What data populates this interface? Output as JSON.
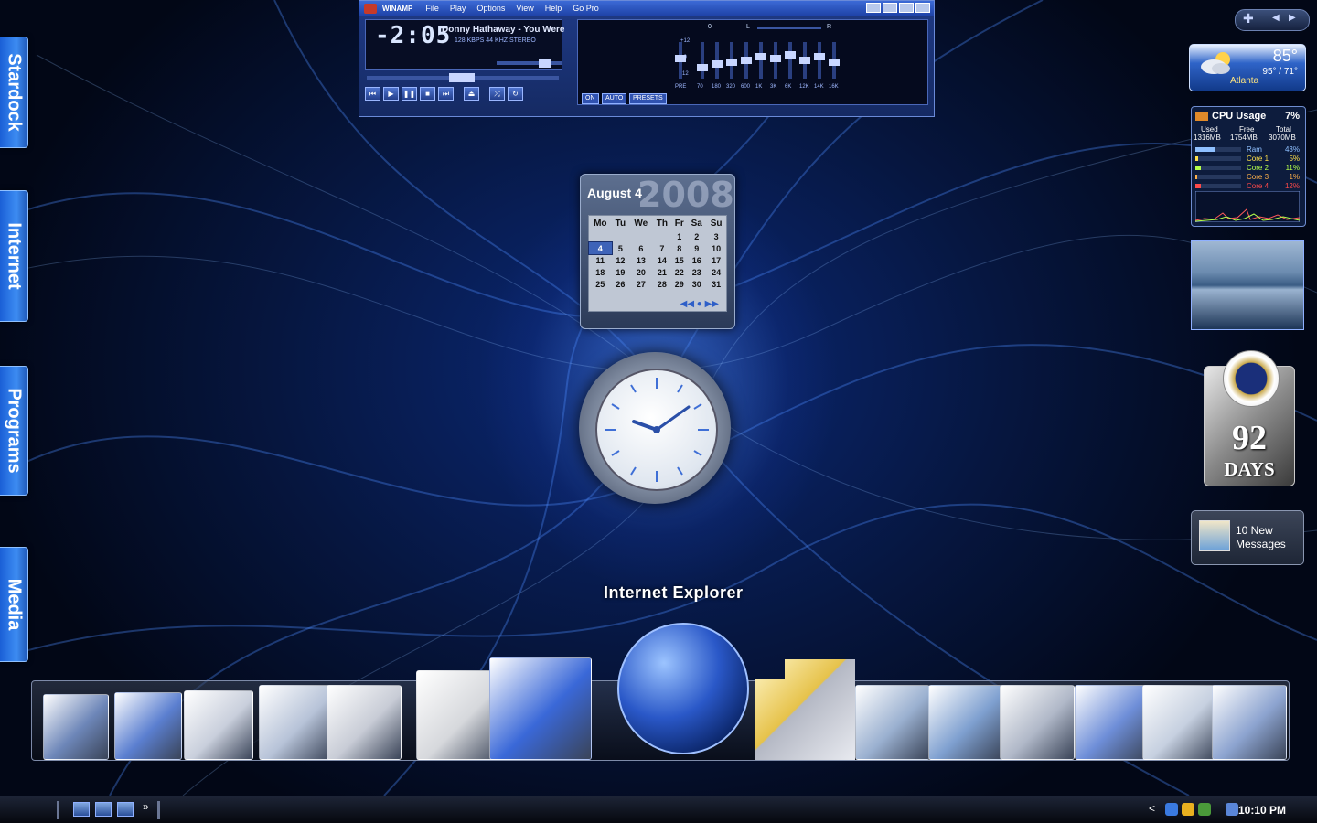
{
  "sidebar_tabs": [
    {
      "label": "Stardock"
    },
    {
      "label": "Internet"
    },
    {
      "label": "Programs"
    },
    {
      "label": "Media"
    }
  ],
  "winamp": {
    "app_name": "WINAMP",
    "menu": [
      "File",
      "Play",
      "Options",
      "View",
      "Help",
      "Go Pro"
    ],
    "time": "-2:05",
    "song": "Donny Hathaway - You Were",
    "kbps": "128",
    "kbps_unit": "KBPS",
    "khz": "44",
    "khz_unit": "KHZ",
    "stereo": "STEREO",
    "eq_labels": [
      "PRE",
      "70",
      "180",
      "320",
      "600",
      "1K",
      "3K",
      "6K",
      "12K",
      "14K",
      "16K"
    ],
    "eq_scale": [
      "+12",
      "+0",
      "-12"
    ],
    "eq_buttons": [
      "ON",
      "AUTO",
      "PRESETS"
    ],
    "balance_left": "L",
    "balance_right": "R",
    "balance_center": "0"
  },
  "calendar": {
    "month_day": "August 4",
    "year": "2008",
    "weekdays": [
      "Mo",
      "Tu",
      "We",
      "Th",
      "Fr",
      "Sa",
      "Su"
    ],
    "weeks": [
      [
        "",
        "",
        "",
        "",
        "1",
        "2",
        "3"
      ],
      [
        "4",
        "5",
        "6",
        "7",
        "8",
        "9",
        "10"
      ],
      [
        "11",
        "12",
        "13",
        "14",
        "15",
        "16",
        "17"
      ],
      [
        "18",
        "19",
        "20",
        "21",
        "22",
        "23",
        "24"
      ],
      [
        "25",
        "26",
        "27",
        "28",
        "29",
        "30",
        "31"
      ]
    ],
    "today": "4"
  },
  "weather": {
    "temp": "85°",
    "hi_lo": "95° / 71°",
    "city": "Atlanta"
  },
  "cpu": {
    "title": "CPU Usage",
    "percent": "7%",
    "used_label": "Used",
    "free_label": "Free",
    "total_label": "Total",
    "used": "1316MB",
    "free": "1754MB",
    "total": "3070MB",
    "rows": [
      {
        "name": "Ram",
        "value": "43%",
        "color": "#8fc0ff",
        "fill": 0.43
      },
      {
        "name": "Core 1",
        "value": "5%",
        "color": "#ffe14a",
        "fill": 0.05
      },
      {
        "name": "Core 2",
        "value": "11%",
        "color": "#b6ff4a",
        "fill": 0.11
      },
      {
        "name": "Core 3",
        "value": "1%",
        "color": "#ffb14a",
        "fill": 0.01
      },
      {
        "name": "Core 4",
        "value": "12%",
        "color": "#ff4a4a",
        "fill": 0.12
      }
    ]
  },
  "countdown": {
    "number": "92",
    "unit": "DAYS"
  },
  "mail": {
    "line1": "10 New",
    "line2": "Messages"
  },
  "dock": {
    "label": "Internet Explorer",
    "icons": [
      "my-computer-icon",
      "recycle-bin-icon",
      "printer-icon",
      "music-folder-icon",
      "video-folder-icon",
      "documents-folder-icon",
      "internet-explorer-icon",
      "globe-icon",
      "favorites-folder-icon",
      "pictures-folder-icon",
      "users-folder-icon",
      "control-panel-icon",
      "clock-folder-icon",
      "network-places-icon",
      "network-computer-icon"
    ]
  },
  "taskbar": {
    "clock": "10:10 PM",
    "overflow": "»",
    "tray_arrow": "<"
  }
}
